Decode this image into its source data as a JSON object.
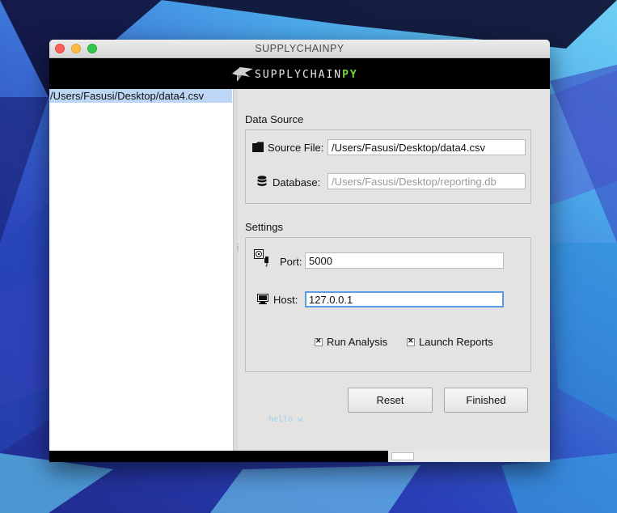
{
  "window": {
    "title": "SUPPLYCHAINPY"
  },
  "banner": {
    "logo_text": "SUPPLYCHAIN",
    "logo_accent": "PY"
  },
  "file_list": {
    "items": [
      "/Users/Fasusi/Desktop/data4.csv"
    ]
  },
  "data_source": {
    "heading": "Data Source",
    "source_file_label": "Source File:",
    "source_file_value": "/Users/Fasusi/Desktop/data4.csv",
    "database_label": "Database:",
    "database_placeholder": "/Users/Fasusi/Desktop/reporting.db"
  },
  "settings": {
    "heading": "Settings",
    "port_label": "Port:",
    "port_value": "5000",
    "host_label": "Host:",
    "host_value": "127.0.0.1",
    "run_analysis_label": "Run Analysis",
    "run_analysis_checked": true,
    "launch_reports_label": "Launch Reports",
    "launch_reports_checked": true
  },
  "buttons": {
    "reset_label": "Reset",
    "finished_label": "Finished"
  },
  "footer": {
    "hello_text": "hello w"
  },
  "icons": {
    "source_file": "folder-icon",
    "database": "database-icon",
    "port": "plug-icon",
    "host": "monitor-icon",
    "logo": "bird-logo-icon"
  },
  "colors": {
    "accent_focus": "#5a9be6",
    "selection": "#bdd6f5",
    "logo_accent": "#7bd23a"
  }
}
